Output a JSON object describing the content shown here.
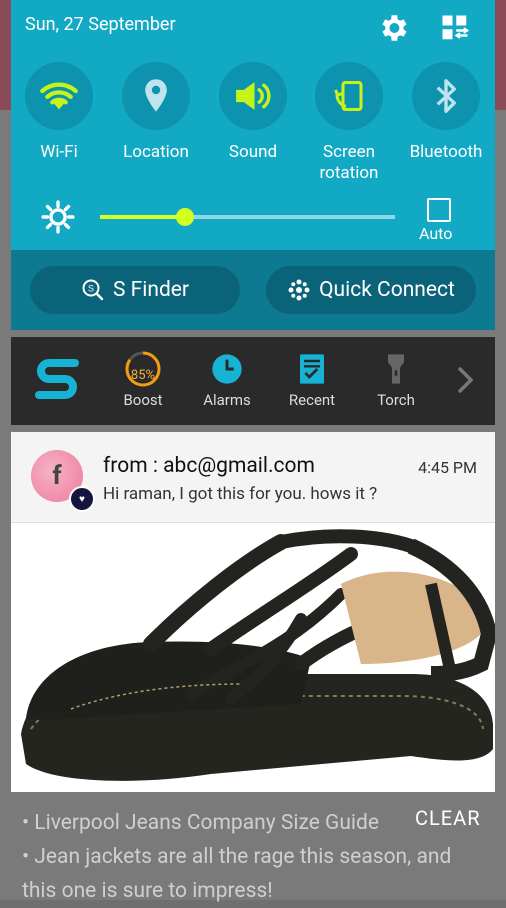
{
  "status": {
    "date": "Sun, 27 September"
  },
  "quick_settings": {
    "toggles": [
      {
        "label": "Wi-Fi",
        "icon": "wifi-icon",
        "active": true
      },
      {
        "label": "Location",
        "icon": "location-icon",
        "active": false
      },
      {
        "label": "Sound",
        "icon": "sound-icon",
        "active": true
      },
      {
        "label": "Screen\nrotation",
        "icon": "rotation-icon",
        "active": true
      },
      {
        "label": "Bluetooth",
        "icon": "bluetooth-icon",
        "active": false
      }
    ],
    "brightness": {
      "level": 0.29,
      "auto_label": "Auto"
    }
  },
  "finder": {
    "s_finder": "S Finder",
    "quick_connect": "Quick Connect"
  },
  "toolbar": {
    "boost_percent": "85%",
    "items": [
      "Boost",
      "Alarms",
      "Recent",
      "Torch"
    ]
  },
  "notification": {
    "title": "from : abc@gmail.com",
    "time": "4:45 PM",
    "body": "Hi raman, I got this for you. hows it ?"
  },
  "background": {
    "lines": [
      "• Liverpool Jeans Company Size Guide",
      "• Jean jackets are all the rage this season, and",
      "this one is sure to impress!"
    ]
  },
  "clear_label": "CLEAR",
  "colors": {
    "accent": "#12a9c4",
    "active": "#c4f41a"
  }
}
